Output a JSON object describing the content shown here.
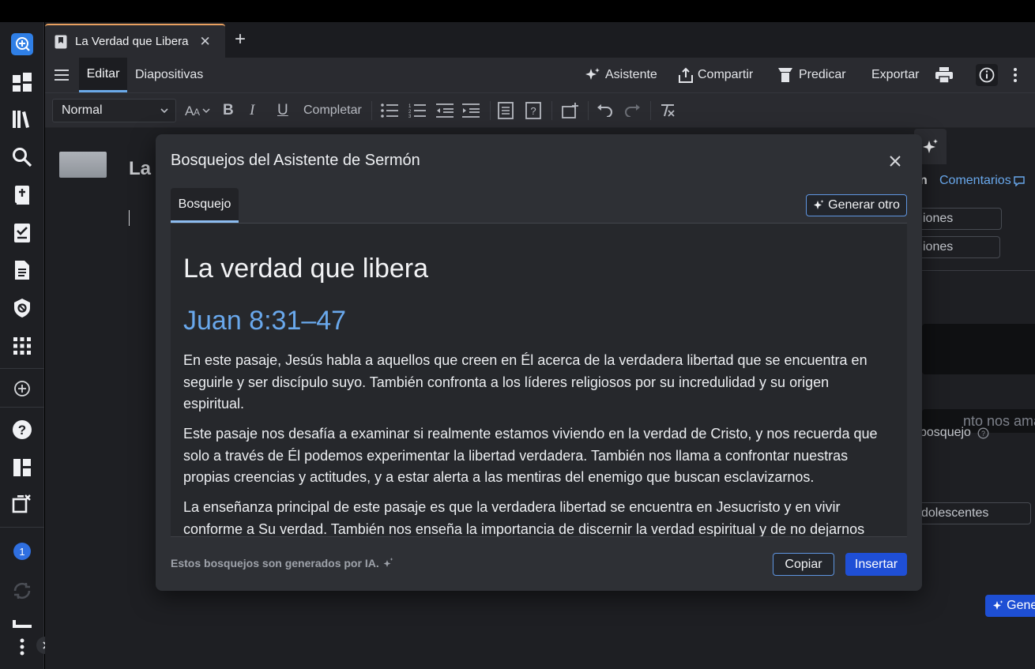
{
  "tab": {
    "title": "La Verdad que Libera"
  },
  "toolbar": {
    "editar": "Editar",
    "diapositivas": "Diapositivas",
    "asistente": "Asistente",
    "compartir": "Compartir",
    "predicar": "Predicar",
    "exportar": "Exportar"
  },
  "format": {
    "style": "Normal",
    "completar": "Completar"
  },
  "editor": {
    "title_peek": "La"
  },
  "side": {
    "comentarios": "Comentarios",
    "tab_frag": "n",
    "chip1": "iones",
    "chip2": "iones",
    "input_text": "nto nos ama D",
    "bosquejo_label": "bosquejo",
    "chip3": "dolescentes",
    "generar": "Generar"
  },
  "modal": {
    "title": "Bosquejos del Asistente de Sermón",
    "tab_bosquejo": "Bosquejo",
    "generar_otro": "Generar otro",
    "outline_title": "La verdad que libera",
    "reference": "Juan 8:31–47",
    "paragraphs": [
      "En este pasaje, Jesús habla a aquellos que creen en Él acerca de la verdadera libertad que se encuentra en seguirle y ser discípulo suyo. También confronta a los líderes religiosos por su incredulidad y su origen espiritual.",
      "Este pasaje nos desafía a examinar si realmente estamos viviendo en la verdad de Cristo, y nos recuerda que solo a través de Él podemos experimentar la libertad verdadera. También nos llama a confrontar nuestras propias creencias y actitudes, y a estar alerta a las mentiras del enemigo que buscan esclavizarnos.",
      "La enseñanza principal de este pasaje es que la verdadera libertad se encuentra en Jesucristo y en vivir conforme a Su verdad. También nos enseña la importancia de discernir la verdad espiritual y de no dejarnos"
    ],
    "footer_note": "Estos bosquejos son generados por IA.",
    "copiar": "Copiar",
    "insertar": "Insertar"
  },
  "rail": {
    "notification_count": "1"
  },
  "colors": {
    "accent": "#1f4fd6",
    "link": "#69a8ec",
    "tab_accent": "#e8a060"
  }
}
